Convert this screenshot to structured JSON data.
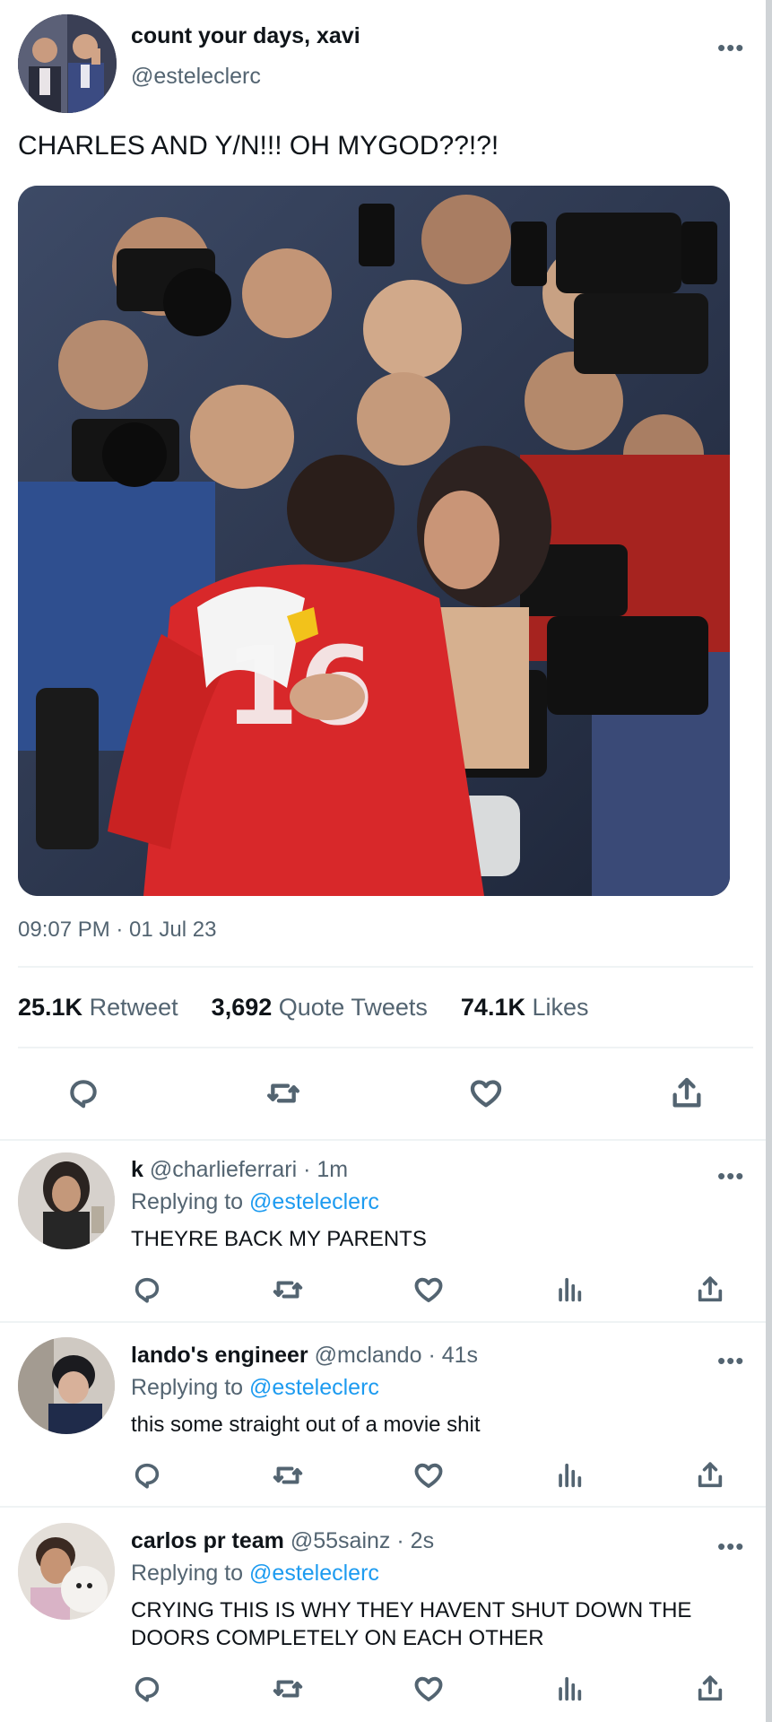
{
  "tweet": {
    "display_name": "count your days, xavi",
    "handle": "@esteleclerc",
    "text": "CHARLES AND Y/N!!! OH MYGOD??!?!",
    "timestamp": "09:07 PM · 01 Jul 23",
    "more_label": "•••",
    "stats": {
      "retweets_count": "25.1K",
      "retweets_label": "Retweet",
      "quotes_count": "3,692",
      "quotes_label": "Quote Tweets",
      "likes_count": "74.1K",
      "likes_label": "Likes"
    },
    "icons": [
      "reply-icon",
      "retweet-icon",
      "like-icon",
      "share-icon"
    ]
  },
  "replies": [
    {
      "display_name": "k",
      "handle": "@charlieferrari",
      "time": "· 1m",
      "replying_prefix": "Replying to",
      "replying_to": "@esteleclerc",
      "text": "THEYRE BACK MY PARENTS",
      "more_label": "•••"
    },
    {
      "display_name": "lando's engineer",
      "handle": "@mclando",
      "time": "· 41s",
      "replying_prefix": "Replying to",
      "replying_to": "@esteleclerc",
      "text": "this some straight out of a movie shit",
      "more_label": "•••"
    },
    {
      "display_name": "carlos pr team",
      "handle": "@55sainz",
      "time": "· 2s",
      "replying_prefix": "Replying to",
      "replying_to": "@esteleclerc",
      "text": "CRYING THIS IS WHY THEY HAVENT SHUT DOWN THE DOORS COMPLETELY ON EACH OTHER",
      "more_label": "•••"
    }
  ],
  "colors": {
    "link": "#1d9bf0",
    "muted": "#536471",
    "divider": "#eff3f4",
    "ferrari_red": "#d8282a"
  }
}
